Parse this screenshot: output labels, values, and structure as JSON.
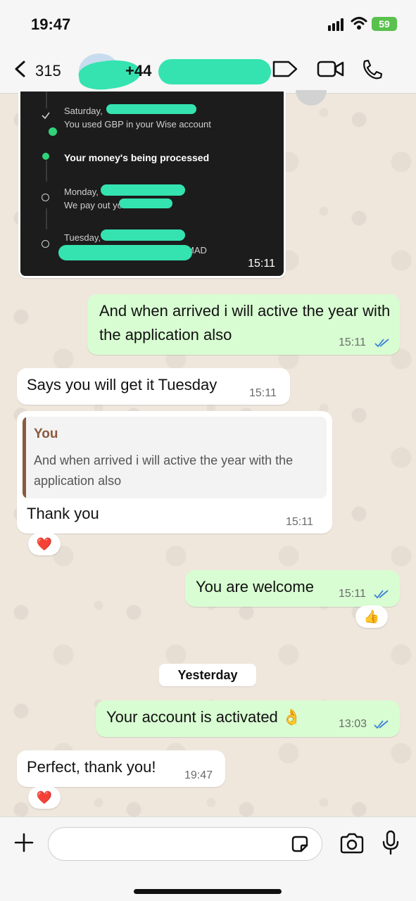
{
  "status_bar": {
    "time": "19:47",
    "battery": "59"
  },
  "header": {
    "back_count": "315",
    "contact_name": "+44"
  },
  "image_message": {
    "items": [
      {
        "title": "Saturday,",
        "subtitle": "You used GBP in your Wise account"
      },
      {
        "title": "Your money's being processed"
      },
      {
        "title": "Monday,",
        "subtitle": "We pay out yo"
      },
      {
        "title": "Tuesday,",
        "subtitle": "MAD"
      }
    ],
    "time": "15:11"
  },
  "messages": [
    {
      "direction": "out",
      "text": "And when arrived i will active the year with the application also",
      "time": "15:11"
    },
    {
      "direction": "in",
      "text": "Says you will get it Tuesday",
      "time": "15:11"
    },
    {
      "direction": "in",
      "quote_author": "You",
      "quote_text": "And when arrived i will active the year with the application also",
      "text": "Thank you",
      "time": "15:11",
      "reaction": "❤️"
    },
    {
      "direction": "out",
      "text": "You are welcome",
      "time": "15:11",
      "reaction": "👍"
    },
    {
      "direction": "out",
      "text": "Your account is activated 👌",
      "time": "13:03"
    },
    {
      "direction": "in",
      "text": "Perfect, thank you!",
      "time": "19:47",
      "reaction": "❤️"
    }
  ],
  "date_separator": "Yesterday",
  "composer": {
    "placeholder": ""
  },
  "colors": {
    "outgoing_bubble": "#d8fdd2",
    "incoming_bubble": "#ffffff",
    "read_ticks": "#3b82d6",
    "wise_green": "#2fd37a"
  }
}
